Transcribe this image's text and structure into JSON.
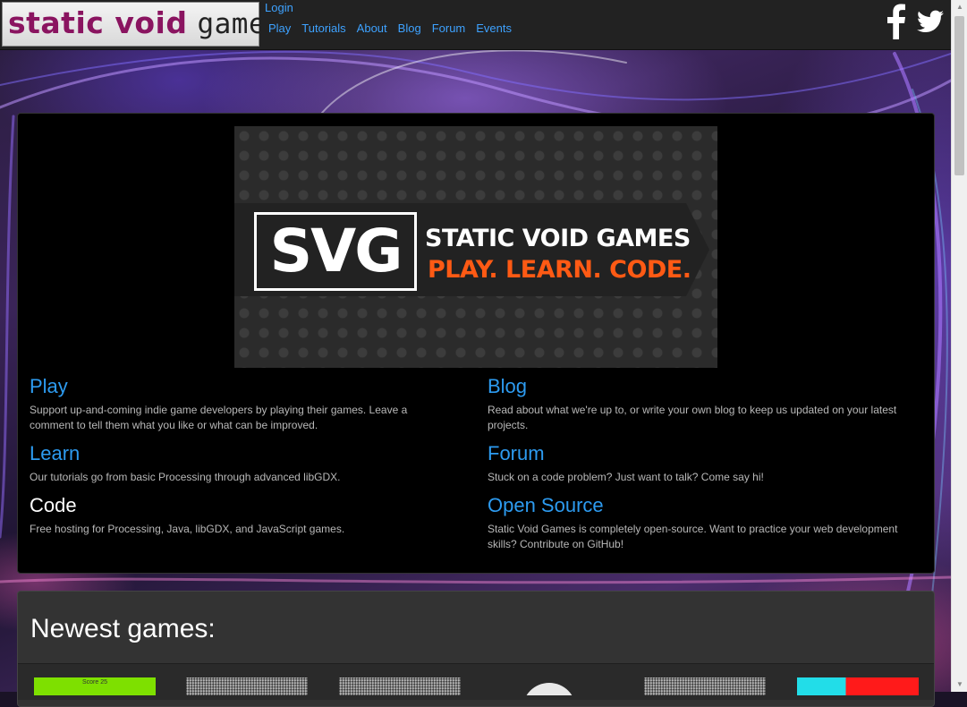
{
  "header": {
    "logo": {
      "part1": "static void",
      "part2": "games"
    },
    "login_label": "Login",
    "nav": [
      {
        "label": "Play"
      },
      {
        "label": "Tutorials"
      },
      {
        "label": "About"
      },
      {
        "label": "Blog"
      },
      {
        "label": "Forum"
      },
      {
        "label": "Events"
      }
    ],
    "social": [
      {
        "icon": "facebook-icon"
      },
      {
        "icon": "twitter-icon"
      }
    ]
  },
  "banner": {
    "badge": "SVG",
    "title": "STATIC VOID GAMES",
    "tagline": "PLAY. LEARN. CODE."
  },
  "sections": {
    "play": {
      "title": "Play",
      "text": "Support up-and-coming indie game developers by playing their games. Leave a comment to tell them what you like or what can be improved."
    },
    "learn": {
      "title": "Learn",
      "text": "Our tutorials go from basic Processing through advanced libGDX."
    },
    "code": {
      "title": "Code",
      "text": "Free hosting for Processing, Java, libGDX, and JavaScript games."
    },
    "blog": {
      "title": "Blog",
      "text": "Read about what we're up to, or write your own blog to keep us updated on your latest projects."
    },
    "forum": {
      "title": "Forum",
      "text": "Stuck on a code problem? Just want to talk? Come say hi!"
    },
    "open_source": {
      "title": "Open Source",
      "text": "Static Void Games is completely open-source. Want to practice your web development skills? Contribute on GitHub!"
    }
  },
  "newest": {
    "heading": "Newest games:",
    "first_thumb_caption": "Score 25"
  },
  "colors": {
    "link": "#2d9bf0",
    "accent_orange": "#ff5a14",
    "logo_purple": "#8a1460"
  }
}
